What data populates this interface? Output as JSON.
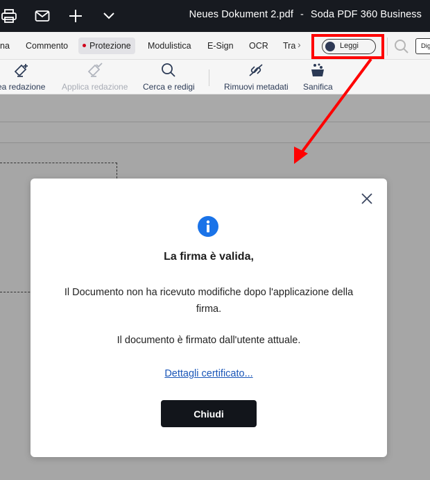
{
  "window": {
    "doc_name": "Neues Dokument 2.pdf",
    "separator": "-",
    "app_name": "Soda PDF 360 Business"
  },
  "tabs": [
    {
      "label": "na"
    },
    {
      "label": "Commento"
    },
    {
      "label": "Protezione",
      "active": true
    },
    {
      "label": "Modulistica"
    },
    {
      "label": "E-Sign"
    },
    {
      "label": "OCR"
    },
    {
      "label": "Tra"
    }
  ],
  "read_toggle": {
    "label": "Leggi"
  },
  "dig_button": {
    "label": "Dig"
  },
  "tools": [
    {
      "label": "ea redazione",
      "icon": "eraser-plus-icon",
      "enabled": true
    },
    {
      "label": "Applica redazione",
      "icon": "eraser-check-icon",
      "enabled": false
    },
    {
      "label": "Cerca e redigi",
      "icon": "search-icon",
      "enabled": true
    },
    {
      "label": "Rimuovi metadati",
      "icon": "remove-metadata-icon",
      "enabled": true
    },
    {
      "label": "Sanifica",
      "icon": "sanitize-icon",
      "enabled": true
    }
  ],
  "dialog": {
    "title": "La firma è valida,",
    "message": "Il Documento non ha ricevuto modifiche dopo l'applicazione della firma.",
    "signer_text": "Il documento è firmato dall'utente attuale.",
    "certificate_link": "Dettagli certificato...",
    "close_button": "Chiudi"
  },
  "colors": {
    "titlebar": "#171a20",
    "annotation_red": "#ff0000",
    "info_blue": "#1a73e8",
    "link_blue": "#1a56b8",
    "button_dark": "#12151b"
  }
}
